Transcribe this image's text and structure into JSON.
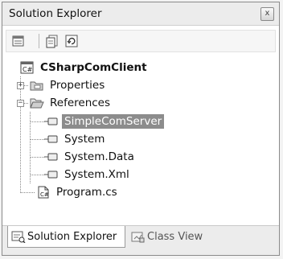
{
  "window": {
    "title": "Solution Explorer",
    "close_glyph": "x"
  },
  "toolbar": {
    "buttons": [
      {
        "icon": "properties-window-icon"
      },
      {
        "icon": "show-all-files-icon"
      },
      {
        "icon": "refresh-icon"
      }
    ]
  },
  "tree": {
    "project": {
      "label": "CSharpComClient",
      "icon": "csharp-project-icon"
    },
    "properties": {
      "label": "Properties",
      "expander": "+",
      "icon": "properties-folder-icon"
    },
    "references": {
      "label": "References",
      "expander": "−",
      "icon": "open-folder-icon",
      "items": [
        {
          "label": "SimpleComServer",
          "selected": true
        },
        {
          "label": "System"
        },
        {
          "label": "System.Data"
        },
        {
          "label": "System.Xml"
        }
      ]
    },
    "program": {
      "label": "Program.cs",
      "icon": "cs-file-icon"
    }
  },
  "tabs": [
    {
      "label": "Solution Explorer",
      "active": true
    },
    {
      "label": "Class View",
      "active": false
    }
  ],
  "colors": {
    "selection": "#8c8c8c",
    "chrome": "#ececec"
  }
}
